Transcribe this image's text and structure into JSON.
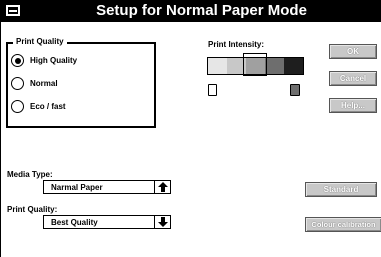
{
  "window": {
    "title": "Setup for Normal Paper Mode"
  },
  "print_quality_group": {
    "label": "Print Quality",
    "options": [
      {
        "label": "High Quality",
        "selected": true
      },
      {
        "label": "Normal",
        "selected": false
      },
      {
        "label": "Eco / fast",
        "selected": false
      }
    ]
  },
  "print_intensity": {
    "label": "Print Intensity:",
    "swatch_colors": [
      "#e6e6e6",
      "#c8c8c8",
      "#a0a0a0",
      "#6e6e6e",
      "#1e1e1e"
    ],
    "selected_index": 2
  },
  "buttons": {
    "ok": "OK",
    "cancel": "Cancel",
    "help": "Help...",
    "standard": "Standard",
    "colour_calibration": "Colour calibration"
  },
  "media_type": {
    "label": "Media Type:",
    "value": "Narmal Paper"
  },
  "print_quality_select": {
    "label": "Print Quality:",
    "value": "Best Quality"
  }
}
